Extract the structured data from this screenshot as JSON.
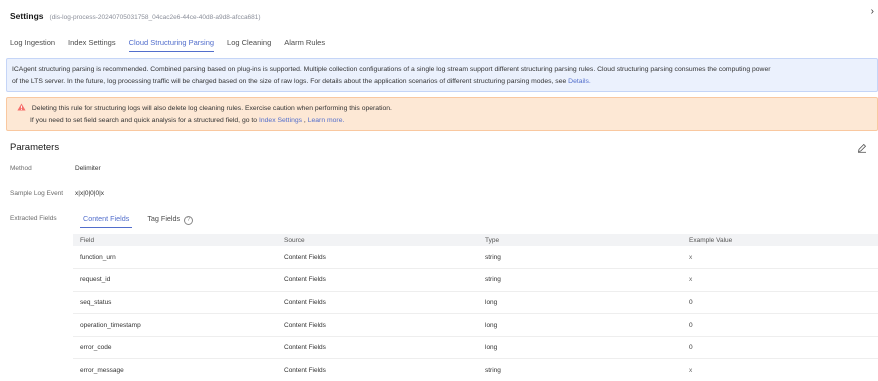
{
  "header": {
    "title": "Settings",
    "subtitle": "(dis-log-process-20240705031758_04cac2e6-44ce-40d8-a9d8-afcca681)",
    "close_glyph": "›"
  },
  "tabs": [
    {
      "label": "Log Ingestion",
      "active": false
    },
    {
      "label": "Index Settings",
      "active": false
    },
    {
      "label": "Cloud Structuring Parsing",
      "active": true
    },
    {
      "label": "Log Cleaning",
      "active": false
    },
    {
      "label": "Alarm Rules",
      "active": false
    }
  ],
  "info": {
    "line1": "ICAgent structuring parsing is recommended. Combined parsing based on plug-ins is supported. Multiple collection configurations of a single log stream support different structuring parsing rules. Cloud structuring parsing consumes the computing power",
    "line2": "of the LTS server. In the future, log processing traffic will be charged based on the size of raw logs. For details about the application scenarios of different structuring parsing modes, see",
    "link": "Details.",
    "accent": "#526ecc"
  },
  "warning": {
    "line1": "Deleting this rule for structuring logs will also delete log cleaning rules. Exercise caution when performing this operation.",
    "line2_prefix": "If you need to set field search and quick analysis for a structured field, go to",
    "link1": "Index Settings",
    "sep": " , ",
    "link2": "Learn more.",
    "icon": "warning-triangle-icon",
    "icon_color": "#f66f6a"
  },
  "parameters": {
    "title": "Parameters",
    "method_label": "Method",
    "method_value": "Delimiter",
    "sample_label": "Sample Log Event",
    "sample_value": "x|x|0|0|0|x",
    "extracted_label": "Extracted Fields"
  },
  "subtabs": {
    "content": "Content Fields",
    "tag": "Tag Fields",
    "help": "?"
  },
  "table": {
    "headers": [
      "Field",
      "Source",
      "Type",
      "Example Value"
    ],
    "rows": [
      {
        "field": "function_urn",
        "source": "Content Fields",
        "type": "string",
        "example": "x"
      },
      {
        "field": "request_id",
        "source": "Content Fields",
        "type": "string",
        "example": "x"
      },
      {
        "field": "seq_status",
        "source": "Content Fields",
        "type": "long",
        "example": "0"
      },
      {
        "field": "operation_timestamp",
        "source": "Content Fields",
        "type": "long",
        "example": "0"
      },
      {
        "field": "error_code",
        "source": "Content Fields",
        "type": "long",
        "example": "0"
      },
      {
        "field": "error_message",
        "source": "Content Fields",
        "type": "string",
        "example": "x"
      }
    ]
  }
}
